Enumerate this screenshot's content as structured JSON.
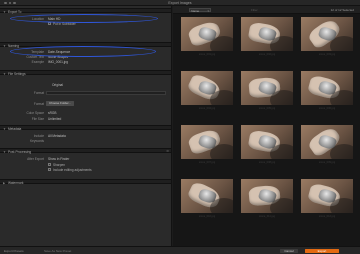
{
  "window": {
    "title": "Export Images"
  },
  "left_panel": {
    "sections": [
      {
        "label": "Export To"
      },
      {
        "label": "Naming"
      },
      {
        "label": "File Settings"
      },
      {
        "label": "Metadata"
      },
      {
        "label": "Post-Processing"
      },
      {
        "label": "Watermark"
      }
    ],
    "export_to": {
      "location_key": "Location",
      "location_value": "Main HD",
      "checkbox_label": "Put in Subfolder"
    },
    "naming": {
      "template_key": "Template",
      "template_value": "Date-Sequence",
      "custom_key": "Custom Text",
      "custom_value": "Stone Shapes",
      "example_key": "Example",
      "example_value": "IMG_0001.jpg"
    },
    "file_settings": {
      "format_key": "Format",
      "format_value": "Original",
      "button_label": "Choose Folder...",
      "color_key": "Color Space",
      "color_value": "sRGB",
      "limit_key": "File Size",
      "limit_value": "Unlimited"
    },
    "metadata": {
      "include_key": "Include",
      "include_value": "All Metadata",
      "keywords_key": "Keywords"
    },
    "post_processing": {
      "after_key": "After Export",
      "after_value": "Show in Finder",
      "opt1": "Sharpen",
      "opt2": "Include editing adjustments"
    }
  },
  "right_panel": {
    "sort_select": "Name",
    "filter_placeholder": "Filter",
    "count_label": "12 of 12 Selected",
    "thumb_labels": [
      "stone_001.jpg",
      "stone_002.jpg",
      "stone_003.jpg",
      "stone_004.jpg",
      "stone_005.jpg",
      "stone_006.jpg",
      "stone_007.jpg",
      "stone_008.jpg",
      "stone_009.jpg",
      "stone_010.jpg",
      "stone_011.jpg",
      "stone_012.jpg"
    ]
  },
  "bottom_bar": {
    "left_text": "Export Presets",
    "left_text2": "Save As New Preset",
    "cancel_label": "Cancel",
    "export_label": "Export"
  },
  "accent_colors": {
    "highlight_oval": "#2f56d8",
    "export_button": "#e36a12"
  }
}
